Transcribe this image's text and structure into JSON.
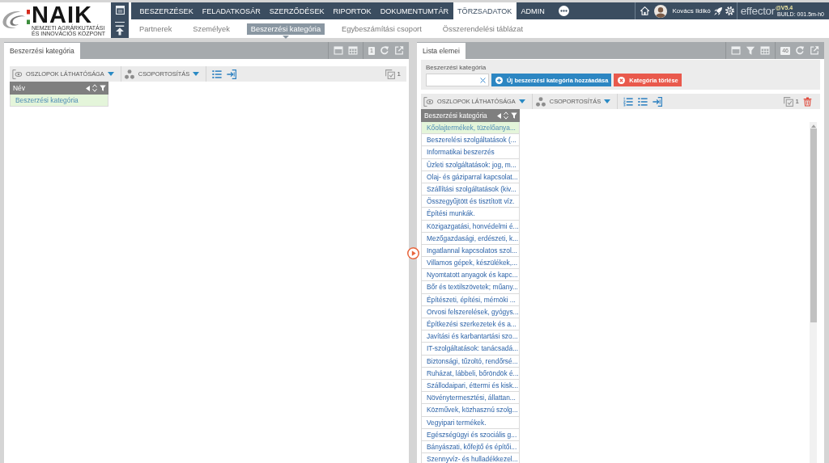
{
  "logo": {
    "title": "NAIK",
    "subtitle": [
      "NEMZETI AGRÁRKUTATÁSI",
      "ÉS INNOVÁCIÓS KÖZPONT"
    ]
  },
  "main_nav": [
    {
      "label": "BESZERZÉSEK",
      "selected": false
    },
    {
      "label": "FELADATKOSÁR",
      "selected": false
    },
    {
      "label": "SZERZŐDÉSEK",
      "selected": false
    },
    {
      "label": "RIPORTOK",
      "selected": false
    },
    {
      "label": "DOKUMENTUMTÁR",
      "selected": false
    },
    {
      "label": "TÖRZSADATOK",
      "selected": true
    },
    {
      "label": "ADMIN",
      "selected": false
    }
  ],
  "user": {
    "name": "Kovács Ildikó"
  },
  "brand": {
    "name": "effector",
    "version": "@V5.4",
    "build": "BUILD: 001.5m-h0"
  },
  "sub_nav": [
    {
      "label": "Partnerek",
      "selected": false
    },
    {
      "label": "Személyek",
      "selected": false
    },
    {
      "label": "Beszerzési kategória",
      "selected": true
    },
    {
      "label": "Egybeszámítási csoport",
      "selected": false
    },
    {
      "label": "Összerendelési táblázat",
      "selected": false
    }
  ],
  "left_panel": {
    "tab": "Beszerzési kategória",
    "record_count": "1",
    "toolbar": {
      "columns": "OSZLOPOK LÁTHATÓSÁGA",
      "grouping": "CSOPORTOSÍTÁS",
      "selected_count": "1"
    },
    "table": {
      "column": "Név",
      "rows": [
        {
          "text": "Beszerzési kategória",
          "selected": true
        }
      ]
    }
  },
  "right_panel": {
    "tab": "Lista elemei",
    "record_count": "46",
    "filter": {
      "label": "Beszerzési kategória",
      "buttons": [
        {
          "label": "Új beszerzési kategória hozzáadása",
          "kind": "add"
        },
        {
          "label": "Kategória törlése",
          "kind": "delete"
        }
      ]
    },
    "toolbar": {
      "columns": "OSZLOPOK LÁTHATÓSÁGA",
      "grouping": "CSOPORTOSÍTÁS",
      "selected_count": "1"
    },
    "table": {
      "column": "Beszerzési kategória",
      "rows": [
        {
          "text": "Kőolajtermékek, tüzelőanya...",
          "selected": true
        },
        {
          "text": "Beszerelési szolgáltatások (...",
          "selected": false
        },
        {
          "text": "Informatikai beszerzés",
          "selected": false
        },
        {
          "text": "Üzleti szolgáltatások: jog, m...",
          "selected": false
        },
        {
          "text": "Olaj- és gáziparral kapcsolat...",
          "selected": false
        },
        {
          "text": "Szállítási szolgáltatások (kiv...",
          "selected": false
        },
        {
          "text": "Összegyűjtött és tisztított víz.",
          "selected": false
        },
        {
          "text": "Építési munkák.",
          "selected": false
        },
        {
          "text": "Közigazgatási, honvédelmi é...",
          "selected": false
        },
        {
          "text": "Mezőgazdasági, erdészeti, k...",
          "selected": false
        },
        {
          "text": "Ingatlannal kapcsolatos szol...",
          "selected": false
        },
        {
          "text": "Villamos gépek, készülékek,...",
          "selected": false
        },
        {
          "text": "Nyomtatott anyagok és kapc...",
          "selected": false
        },
        {
          "text": "Bőr és textilszövetek; műany...",
          "selected": false
        },
        {
          "text": "Építészeti, építési, mérnöki ...",
          "selected": false
        },
        {
          "text": "Orvosi felszerelések, gyógys...",
          "selected": false
        },
        {
          "text": "Építkezési szerkezetek és a...",
          "selected": false
        },
        {
          "text": "Javítási és karbantartási szo...",
          "selected": false
        },
        {
          "text": "IT-szolgáltatások: tanácsadá...",
          "selected": false
        },
        {
          "text": "Biztonsági, tűzoltó, rendőrsé...",
          "selected": false
        },
        {
          "text": "Ruházat, lábbeli, bőröndök é...",
          "selected": false
        },
        {
          "text": "Szállodaipari, éttermi és kisk...",
          "selected": false
        },
        {
          "text": "Növénytermesztési, állattan...",
          "selected": false
        },
        {
          "text": "Közművek, közhasznú szolg...",
          "selected": false
        },
        {
          "text": "Vegyipari termékek.",
          "selected": false
        },
        {
          "text": "Egészségügyi és szociális g...",
          "selected": false
        },
        {
          "text": "Bányászati, kőfejtő és építői...",
          "selected": false
        },
        {
          "text": "Szennyvíz- és hulladékkezel...",
          "selected": false
        }
      ]
    }
  }
}
